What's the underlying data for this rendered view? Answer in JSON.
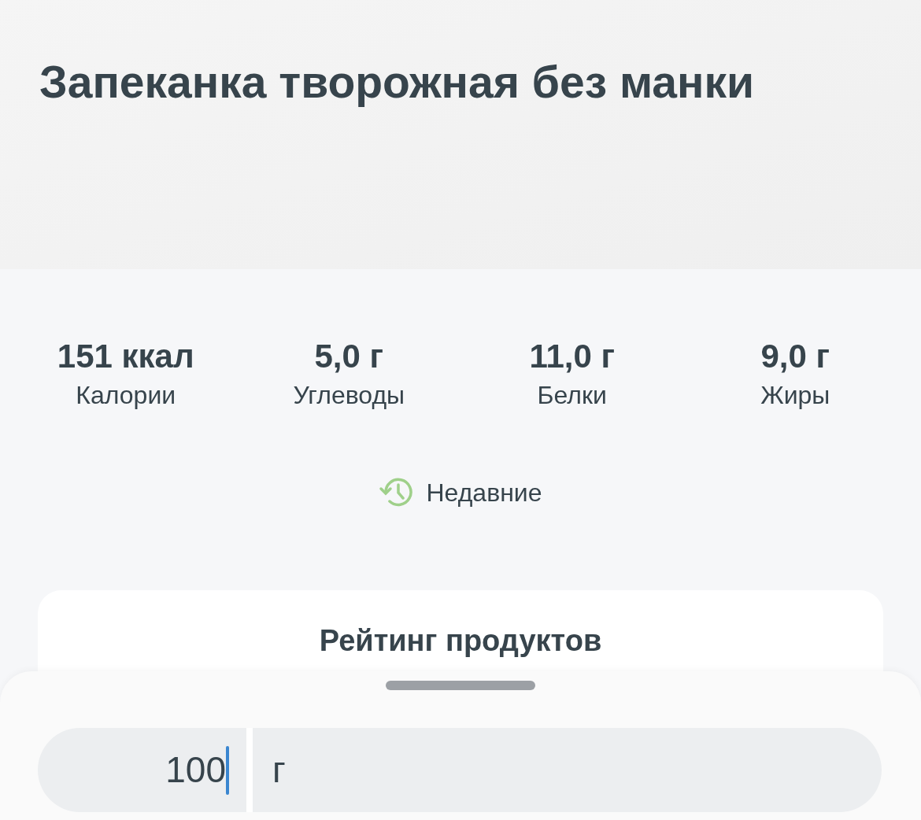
{
  "title": "Запеканка творожная без манки",
  "nutrients": [
    {
      "value": "151 ккал",
      "label": "Калории"
    },
    {
      "value": "5,0 г",
      "label": "Углеводы"
    },
    {
      "value": "11,0 г",
      "label": "Белки"
    },
    {
      "value": "9,0 г",
      "label": "Жиры"
    }
  ],
  "recent_link": "Недавние",
  "rating_card": {
    "title": "Рейтинг продуктов"
  },
  "amount_sheet": {
    "amount": "100",
    "unit": "г"
  }
}
